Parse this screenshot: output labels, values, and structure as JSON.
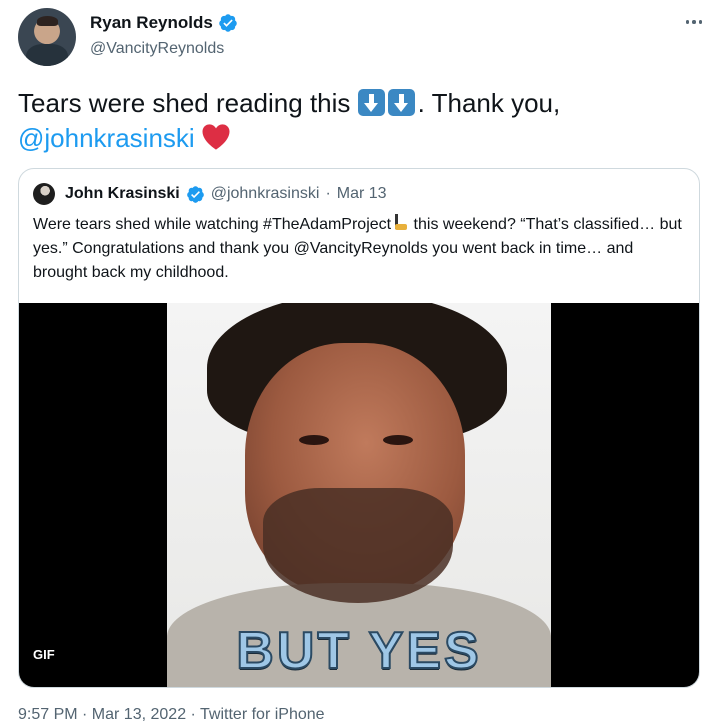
{
  "tweet": {
    "author": {
      "display_name": "Ryan Reynolds",
      "handle": "@VancityReynolds",
      "verified": true
    },
    "text_before": "Tears were shed reading this ",
    "text_after": ". Thank you,",
    "mention": "@johnkrasinski",
    "emojis": [
      "down-arrow-emoji",
      "down-arrow-emoji",
      "red-heart-emoji"
    ],
    "timestamp": "9:57 PM · Mar 13, 2022",
    "separator": " · ",
    "source": "Twitter for iPhone"
  },
  "quoted": {
    "display_name": "John Krasinski",
    "handle": "@johnkrasinski",
    "separator": " · ",
    "date": "Mar 13",
    "verified": true,
    "text_part1": "Were tears shed while watching #TheAdamProject",
    "text_part2": " this weekend?  “That’s classified… but yes.”  Congratulations and thank you @VancityReynolds you went back in time… and brought back my childhood.",
    "media": {
      "badge": "GIF",
      "caption": "BUT YES"
    }
  },
  "colors": {
    "accent": "#1d9bf0",
    "text": "#0f1419",
    "muted": "#536471",
    "border": "#cfd9de",
    "heart": "#dd2e44"
  }
}
